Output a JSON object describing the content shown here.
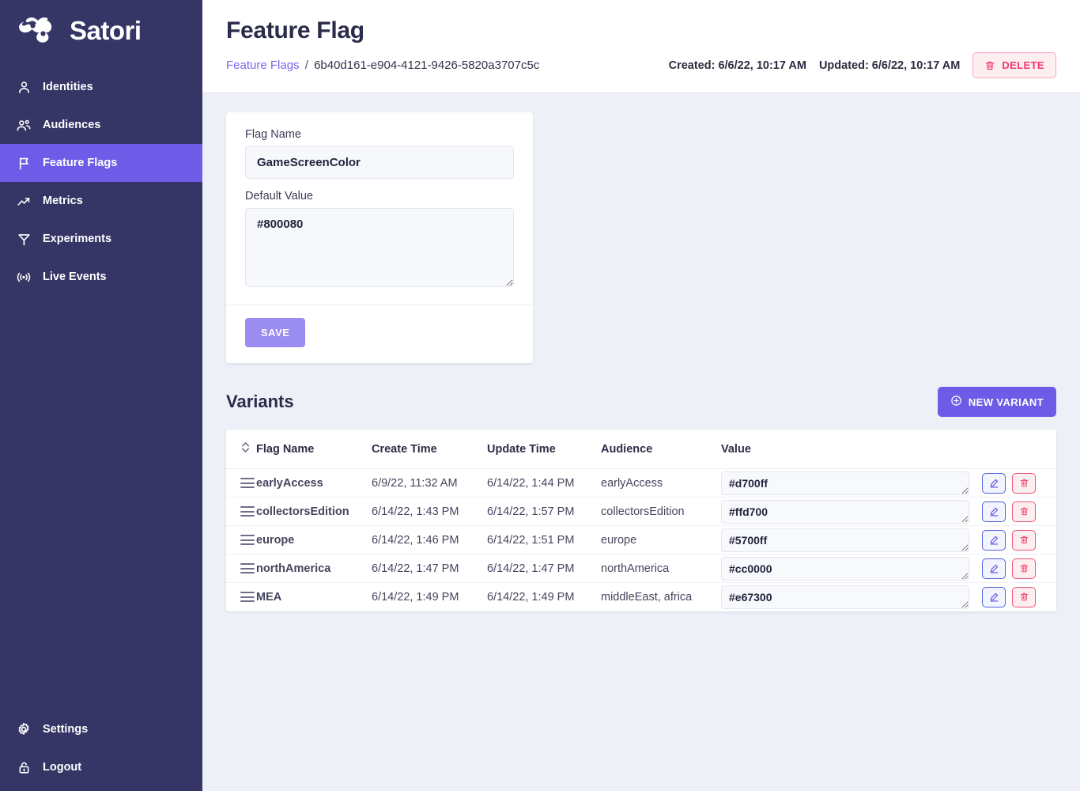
{
  "brand": {
    "name": "Satori",
    "logo_icon": "satori-knot-logo"
  },
  "sidebar": {
    "items": [
      {
        "label": "Identities",
        "icon": "user-icon",
        "active": false
      },
      {
        "label": "Audiences",
        "icon": "users-icon",
        "active": false
      },
      {
        "label": "Feature Flags",
        "icon": "flag-icon",
        "active": true
      },
      {
        "label": "Metrics",
        "icon": "trending-up-icon",
        "active": false
      },
      {
        "label": "Experiments",
        "icon": "funnel-icon",
        "active": false
      },
      {
        "label": "Live Events",
        "icon": "broadcast-icon",
        "active": false
      }
    ],
    "bottom_items": [
      {
        "label": "Settings",
        "icon": "gear-icon"
      },
      {
        "label": "Logout",
        "icon": "lock-icon"
      }
    ]
  },
  "header": {
    "title": "Feature Flag",
    "breadcrumb_link": "Feature Flags",
    "breadcrumb_separator": "/",
    "breadcrumb_id": "6b40d161-e904-4121-9426-5820a3707c5c",
    "created": "Created: 6/6/22, 10:17 AM",
    "updated": "Updated: 6/6/22, 10:17 AM",
    "delete_label": "DELETE",
    "delete_icon": "trash-icon"
  },
  "form": {
    "flag_name_label": "Flag Name",
    "flag_name_value": "GameScreenColor",
    "flag_name_placeholder": "Flag Name",
    "default_value_label": "Default Value",
    "default_value_value": "#800080",
    "default_value_placeholder": "Default Value",
    "save_label": "SAVE"
  },
  "variants": {
    "title": "Variants",
    "new_variant_label": "NEW VARIANT",
    "new_variant_icon": "plus-circle-icon",
    "sort_icon": "sort-updown-icon",
    "columns": [
      "Flag Name",
      "Create Time",
      "Update Time",
      "Audience",
      "Value"
    ],
    "rows": [
      {
        "handle_icon": "drag-handle-icon",
        "name": "earlyAccess",
        "create": "6/9/22, 11:32 AM",
        "update": "6/14/22, 1:44 PM",
        "audience": "earlyAccess",
        "value": "#d700ff",
        "edit_icon": "pencil-icon",
        "delete_icon": "trash-icon"
      },
      {
        "handle_icon": "drag-handle-icon",
        "name": "collectorsEdition",
        "create": "6/14/22, 1:43 PM",
        "update": "6/14/22, 1:57 PM",
        "audience": "collectorsEdition",
        "value": "#ffd700",
        "edit_icon": "pencil-icon",
        "delete_icon": "trash-icon"
      },
      {
        "handle_icon": "drag-handle-icon",
        "name": "europe",
        "create": "6/14/22, 1:46 PM",
        "update": "6/14/22, 1:51 PM",
        "audience": "europe",
        "value": "#5700ff",
        "edit_icon": "pencil-icon",
        "delete_icon": "trash-icon"
      },
      {
        "handle_icon": "drag-handle-icon",
        "name": "northAmerica",
        "create": "6/14/22, 1:47 PM",
        "update": "6/14/22, 1:47 PM",
        "audience": "northAmerica",
        "value": "#cc0000",
        "edit_icon": "pencil-icon",
        "delete_icon": "trash-icon"
      },
      {
        "handle_icon": "drag-handle-icon",
        "name": "MEA",
        "create": "6/14/22, 1:49 PM",
        "update": "6/14/22, 1:49 PM",
        "audience": "middleEast, africa",
        "value": "#e67300",
        "edit_icon": "pencil-icon",
        "delete_icon": "trash-icon"
      }
    ]
  },
  "colors": {
    "sidebar_bg": "#353566",
    "accent": "#6e5ce8",
    "accent_muted": "#9a8cf0",
    "link": "#7b68ee",
    "danger": "#f2386c",
    "page_bg": "#eef0f8"
  }
}
